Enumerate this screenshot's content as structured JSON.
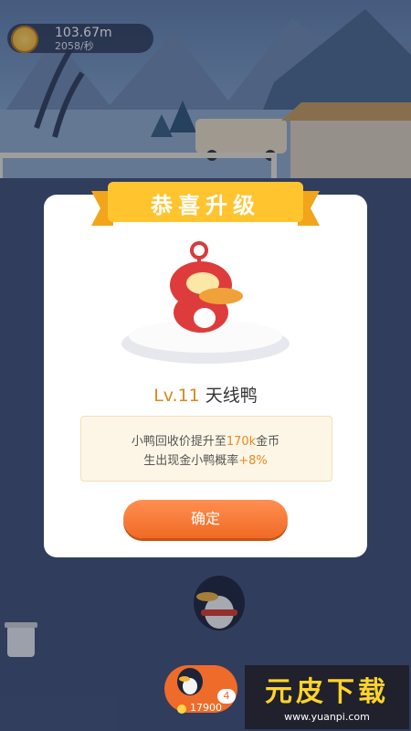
{
  "hud": {
    "coins": "103.67m",
    "rate": "2058/秒"
  },
  "dialog": {
    "ribbon": "恭喜升级",
    "level": "Lv.11",
    "name": "天线鸭",
    "line1_prefix": "小鸭回收价提升至",
    "line1_value": "170k",
    "line1_suffix": "金币",
    "line2_prefix": "生出现金小鸭概率",
    "line2_value": "+8%",
    "confirm": "确定"
  },
  "bottom_bar": {
    "level": "4",
    "price": "17900"
  },
  "watermark": {
    "title": "元皮下载",
    "url": "www.yuanpi.com"
  },
  "colors": {
    "ribbon": "#ffc42e",
    "accent": "#e58a24",
    "button": "#f06a24"
  }
}
